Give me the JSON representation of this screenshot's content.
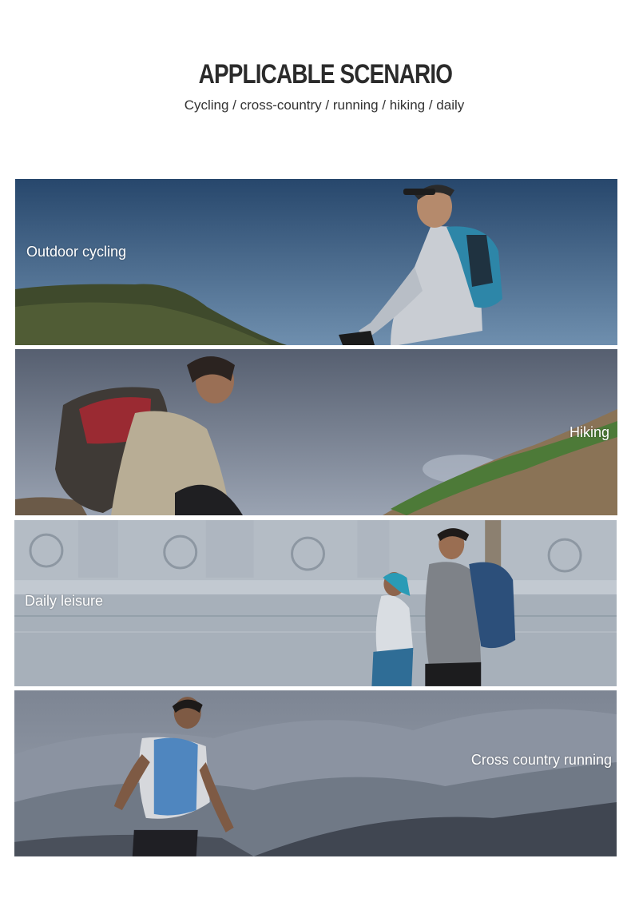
{
  "header": {
    "title": "APPLICABLE SCENARIO",
    "subtitle": "Cycling / cross-country / running / hiking / daily"
  },
  "scenarios": [
    {
      "label": "Outdoor cycling"
    },
    {
      "label": "Hiking"
    },
    {
      "label": "Daily leisure"
    },
    {
      "label": "Cross country running"
    }
  ]
}
